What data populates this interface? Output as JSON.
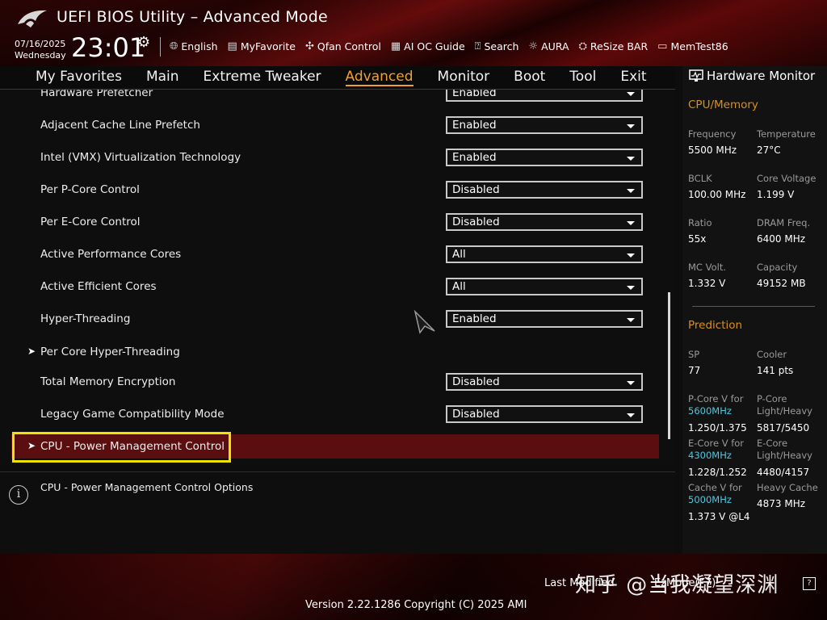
{
  "header": {
    "title": "UEFI BIOS Utility – Advanced Mode",
    "date": "07/16/2025",
    "day": "Wednesday",
    "time": "23:01",
    "toolbar": [
      {
        "icon": "globe-icon",
        "label": "English"
      },
      {
        "icon": "favorite-icon",
        "label": "MyFavorite"
      },
      {
        "icon": "fan-icon",
        "label": "Qfan Control"
      },
      {
        "icon": "ai-chip-icon",
        "label": "AI OC Guide"
      },
      {
        "icon": "search-icon",
        "label": "Search"
      },
      {
        "icon": "aura-light-icon",
        "label": "AURA"
      },
      {
        "icon": "resize-bar-icon",
        "label": "ReSize BAR"
      },
      {
        "icon": "memtest-icon",
        "label": "MemTest86"
      }
    ]
  },
  "menu": {
    "items": [
      "My Favorites",
      "Main",
      "Extreme Tweaker",
      "Advanced",
      "Monitor",
      "Boot",
      "Tool",
      "Exit"
    ],
    "active": "Advanced"
  },
  "settings": [
    {
      "label": "Hardware Prefetcher",
      "value": "Enabled"
    },
    {
      "label": "Adjacent Cache Line Prefetch",
      "value": "Enabled"
    },
    {
      "label": "Intel (VMX) Virtualization Technology",
      "value": "Enabled"
    },
    {
      "label": "Per P-Core Control",
      "value": "Disabled"
    },
    {
      "label": "Per E-Core Control",
      "value": "Disabled"
    },
    {
      "label": "Active Performance Cores",
      "value": "All"
    },
    {
      "label": "Active Efficient Cores",
      "value": "All"
    },
    {
      "label": "Hyper-Threading",
      "value": "Enabled"
    },
    {
      "label": "Per Core Hyper-Threading",
      "submenu": true
    },
    {
      "label": "Total Memory Encryption",
      "value": "Disabled"
    },
    {
      "label": "Legacy Game Compatibility Mode",
      "value": "Disabled"
    },
    {
      "label": "CPU - Power Management Control",
      "submenu": true,
      "selected": true
    }
  ],
  "help": {
    "text": "CPU - Power Management Control Options"
  },
  "hardware_monitor": {
    "title": "Hardware Monitor",
    "cpu_memory": {
      "heading": "CPU/Memory",
      "frequency_label": "Frequency",
      "frequency": "5500 MHz",
      "temperature_label": "Temperature",
      "temperature": "27°C",
      "bclk_label": "BCLK",
      "bclk": "100.00 MHz",
      "core_voltage_label": "Core Voltage",
      "core_voltage": "1.199 V",
      "ratio_label": "Ratio",
      "ratio": "55x",
      "dram_freq_label": "DRAM Freq.",
      "dram_freq": "6400 MHz",
      "mc_volt_label": "MC Volt.",
      "mc_volt": "1.332 V",
      "capacity_label": "Capacity",
      "capacity": "49152 MB"
    },
    "prediction": {
      "heading": "Prediction",
      "sp_label": "SP",
      "sp": "77",
      "cooler_label": "Cooler",
      "cooler": "141 pts",
      "pcore_v_label": "P-Core V for",
      "pcore_v_freq": "5600MHz",
      "pcore_v": "1.250/1.375",
      "pcore_lh_label1": "P-Core",
      "pcore_lh_label2": "Light/Heavy",
      "pcore_lh": "5817/5450",
      "ecore_v_label": "E-Core V for",
      "ecore_v_freq": "4300MHz",
      "ecore_v": "1.228/1.252",
      "ecore_lh_label1": "E-Core",
      "ecore_lh_label2": "Light/Heavy",
      "ecore_lh": "4480/4157",
      "cache_v_label": "Cache V for",
      "cache_v_freq": "5000MHz",
      "cache_v": "1.373 V @L4",
      "heavy_cache_label": "Heavy Cache",
      "heavy_cache": "4873 MHz"
    }
  },
  "footer": {
    "last_modified": "Last Modified",
    "ezmode": "EzMode(F7)",
    "version": "Version 2.22.1286 Copyright (C) 2025 AMI",
    "watermark": "知乎 @当我凝望深渊"
  },
  "colors": {
    "accent": "#f0a030",
    "selected_row": "#5a0e10",
    "highlight_box": "#f2e200",
    "cyan_text": "#4fc8e0"
  }
}
